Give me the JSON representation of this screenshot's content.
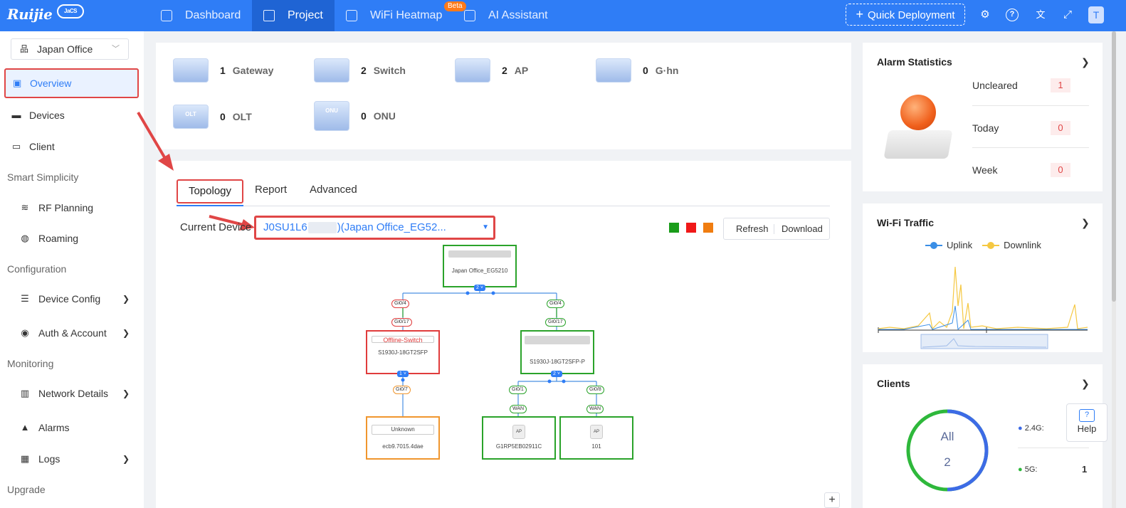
{
  "header": {
    "logo": "Ruijie",
    "logo_badge": "JaCS",
    "nav": [
      {
        "label": "Dashboard",
        "icon": "home-icon"
      },
      {
        "label": "Project",
        "icon": "cube-icon"
      },
      {
        "label": "WiFi Heatmap",
        "icon": "heatmap-icon"
      },
      {
        "label": "AI Assistant",
        "icon": "grid-icon"
      }
    ],
    "beta": "Beta",
    "quick_deployment": "Quick Deployment",
    "quick_icon": "+",
    "avatar": "T"
  },
  "sidebar": {
    "site": "Japan Office",
    "items": {
      "overview": "Overview",
      "devices": "Devices",
      "client": "Client",
      "section_smart": "Smart Simplicity",
      "rf_planning": "RF Planning",
      "roaming": "Roaming",
      "section_config": "Configuration",
      "device_config": "Device Config",
      "auth_account": "Auth & Account",
      "section_monitoring": "Monitoring",
      "network_details": "Network Details",
      "alarms": "Alarms",
      "logs": "Logs",
      "section_upgrade": "Upgrade"
    }
  },
  "devices_summary": [
    {
      "count": "1",
      "label": "Gateway",
      "img": ""
    },
    {
      "count": "2",
      "label": "Switch",
      "img": ""
    },
    {
      "count": "2",
      "label": "AP",
      "img": ""
    },
    {
      "count": "0",
      "label": "G·hn",
      "img": ""
    },
    {
      "count": "0",
      "label": "OLT",
      "img": "OLT"
    },
    {
      "count": "0",
      "label": "ONU",
      "img": "ONU"
    }
  ],
  "tabs": [
    "Topology",
    "Report",
    "Advanced"
  ],
  "topology": {
    "current_device_label": "Current Device",
    "current_device_prefix": "J0SU1L6",
    "current_device_suffix": ")(Japan Office_EG52...",
    "refresh": "Refresh",
    "download": "Download",
    "legend_colors": [
      "#1a9c1a",
      "#f01818",
      "#f07d10"
    ],
    "root": {
      "name": "Japan Office_EG5210",
      "badge": "2"
    },
    "left_uplink_port": "Gi0/4",
    "left_downlink_port": "Gi0/17",
    "left_switch": {
      "status": "Offline-Switch",
      "model": "S1930J-18GT2SFP",
      "badge": "1"
    },
    "left_child_port": "Gi0/7",
    "unknown_node": {
      "name": "Unknown",
      "mac": "ecb9.7015.4dae"
    },
    "right_uplink_port": "Gi0/4",
    "right_downlink_port": "Gi0/17",
    "right_switch": {
      "model": "S1930J-18GT2SFP-P",
      "badge": "2"
    },
    "ap1_port": "Gi0/1",
    "ap1_wan": "WAN",
    "ap1": {
      "icon": "AP",
      "name": "G1RP5EB02911C"
    },
    "ap2_port": "Gi0/8",
    "ap2_wan": "WAN",
    "ap2": {
      "icon": "AP",
      "name": "101"
    },
    "zoom_in": "+"
  },
  "alarm_statistics": {
    "title": "Alarm Statistics",
    "rows": [
      {
        "label": "Uncleared",
        "count": "1"
      },
      {
        "label": "Today",
        "count": "0"
      },
      {
        "label": "Week",
        "count": "0"
      }
    ]
  },
  "wifi_traffic": {
    "title": "Wi-Fi Traffic",
    "legend_uplink": "Uplink",
    "legend_downlink": "Downlink",
    "uplink_color": "#3a8ee6",
    "downlink_color": "#f5c842"
  },
  "clients": {
    "title": "Clients",
    "center_label": "All",
    "center_value": "2",
    "band_24": "2.4G:",
    "band_5": "5G:",
    "band_5_value": "1"
  },
  "help": "Help"
}
